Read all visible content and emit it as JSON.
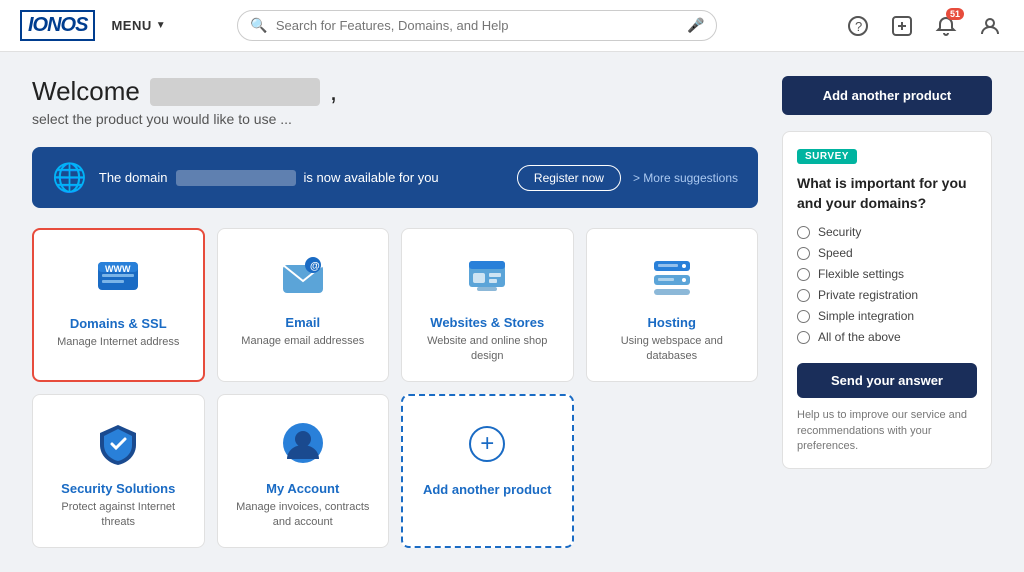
{
  "header": {
    "logo": "IONOS",
    "menu_label": "MENU",
    "search_placeholder": "Search for Features, Domains, and Help",
    "notification_count": "51"
  },
  "welcome": {
    "greeting": "Welcome",
    "subtitle": "select the product you would like to use ...",
    "add_product_btn": "Add another product"
  },
  "domain_banner": {
    "text_before": "The domain",
    "text_after": "is now available for you",
    "register_btn": "Register now",
    "suggestions_link": "> More suggestions"
  },
  "products": [
    {
      "id": "domains-ssl",
      "title": "Domains & SSL",
      "description": "Manage Internet address",
      "selected": true
    },
    {
      "id": "email",
      "title": "Email",
      "description": "Manage email addresses",
      "selected": false
    },
    {
      "id": "websites-stores",
      "title": "Websites & Stores",
      "description": "Website and online shop design",
      "selected": false
    },
    {
      "id": "hosting",
      "title": "Hosting",
      "description": "Using webspace and databases",
      "selected": false
    },
    {
      "id": "security-solutions",
      "title": "Security Solutions",
      "description": "Protect against Internet threats",
      "selected": false
    },
    {
      "id": "my-account",
      "title": "My Account",
      "description": "Manage invoices, contracts and account",
      "selected": false
    },
    {
      "id": "add-another",
      "title": "Add another product",
      "description": "",
      "selected": false,
      "is_add": true
    }
  ],
  "survey": {
    "badge": "SURVEY",
    "question": "What is important for you and your domains?",
    "options": [
      "Security",
      "Speed",
      "Flexible settings",
      "Private registration",
      "Simple integration",
      "All of the above"
    ],
    "send_btn": "Send your answer",
    "footer": "Help us to improve our service and recommendations with your preferences."
  }
}
